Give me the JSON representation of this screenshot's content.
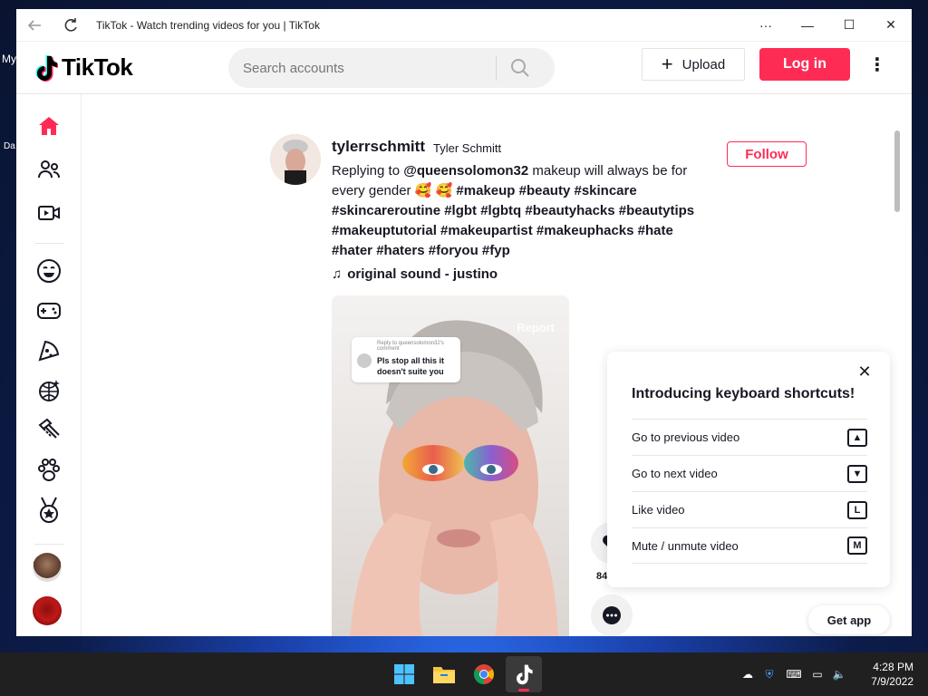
{
  "desktop": {
    "labels": [
      "My",
      "Da"
    ]
  },
  "window": {
    "title": "TikTok - Watch trending videos for you | TikTok",
    "controls": {
      "more": "···",
      "minimize": "—",
      "maximize": "☐",
      "close": "✕"
    }
  },
  "header": {
    "logo_text": "TikTok",
    "search_placeholder": "Search accounts",
    "upload_label": "Upload",
    "login_label": "Log in"
  },
  "sidebar": {
    "items": [
      "home-icon",
      "following-icon",
      "live-icon",
      "comedy-icon",
      "gaming-icon",
      "food-icon",
      "dance-icon",
      "beauty-icon",
      "animals-icon",
      "sports-icon"
    ]
  },
  "post": {
    "username": "tylerrschmitt",
    "nickname": "Tyler Schmitt",
    "caption_prefix": "Replying to ",
    "mention": "@queensolomon32",
    "caption_text": " makeup will always be for every gender 🥰 🥰 ",
    "hashtags": "#makeup #beauty #skincare #skincareroutine #lgbt #lgbtq #beautyhacks #beautytips #makeuptutorial #makeupartist #makeuphacks #hate #hater #haters #foryou #fyp",
    "sound": "original sound - justino",
    "follow_label": "Follow",
    "report_label": "Report",
    "reply_header": "Reply to queensolomon32's comment",
    "reply_text": "Pls stop all this it doesn't suite you",
    "like_count": "84"
  },
  "shortcuts": {
    "title": "Introducing keyboard shortcuts!",
    "items": [
      {
        "label": "Go to previous video",
        "key": "▲"
      },
      {
        "label": "Go to next video",
        "key": "▼"
      },
      {
        "label": "Like video",
        "key": "L"
      },
      {
        "label": "Mute / unmute video",
        "key": "M"
      }
    ]
  },
  "get_app_label": "Get app",
  "taskbar": {
    "time": "4:28 PM",
    "date": "7/9/2022"
  },
  "colors": {
    "brand": "#fe2c55",
    "text": "#161823"
  }
}
